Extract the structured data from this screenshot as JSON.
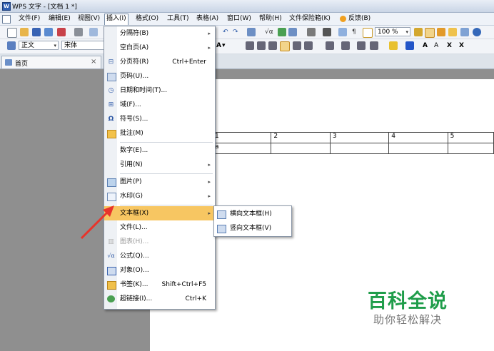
{
  "window": {
    "title": "WPS 文字 - [文档 1 *]"
  },
  "menubar": [
    "文件(F)",
    "编辑(E)",
    "视图(V)",
    "插入(I)",
    "格式(O)",
    "工具(T)",
    "表格(A)",
    "窗口(W)",
    "帮助(H)",
    "文件保险箱(K)",
    "反馈(B)"
  ],
  "toolbar1": {
    "zoom": "100 %"
  },
  "toolbar2": {
    "style": "正文",
    "font": "宋体",
    "size_label": "A",
    "format_buttons": [
      "A",
      "A",
      "X",
      "X"
    ]
  },
  "tabs": {
    "home": "首页",
    "close": "×"
  },
  "insert_menu": [
    {
      "label": "分隔符(B)",
      "icon": "",
      "submenu": true
    },
    {
      "label": "空白页(A)",
      "icon": "",
      "submenu": true
    },
    {
      "label": "分页符(R)",
      "icon": "page-break-icon",
      "shortcut": "Ctrl+Enter"
    },
    {
      "label": "页码(U)...",
      "icon": "page-number-icon"
    },
    {
      "label": "日期和时间(T)...",
      "icon": "date-time-icon"
    },
    {
      "label": "域(F)...",
      "icon": "field-icon"
    },
    {
      "label": "符号(S)...",
      "icon": "omega-icon"
    },
    {
      "label": "批注(M)",
      "icon": "comment-icon"
    },
    {
      "label": "数字(E)...",
      "icon": "",
      "separator_before": true
    },
    {
      "label": "引用(N)",
      "icon": "",
      "submenu": true
    },
    {
      "label": "图片(P)",
      "icon": "picture-icon",
      "submenu": true,
      "separator_before": true
    },
    {
      "label": "水印(G)",
      "icon": "watermark-icon",
      "submenu": true
    },
    {
      "label": "文本框(X)",
      "icon": "",
      "submenu": true,
      "highlighted": true,
      "separator_before": true
    },
    {
      "label": "文件(L)...",
      "icon": ""
    },
    {
      "label": "图表(H)...",
      "icon": "chart-icon",
      "disabled": true
    },
    {
      "label": "公式(Q)...",
      "icon": "formula-icon"
    },
    {
      "label": "对象(O)...",
      "icon": "object-icon"
    },
    {
      "label": "书签(K)...",
      "icon": "bookmark-icon",
      "shortcut": "Shift+Ctrl+F5"
    },
    {
      "label": "超链接(I)...",
      "icon": "hyperlink-icon",
      "shortcut": "Ctrl+K"
    }
  ],
  "textbox_submenu": [
    "横向文本框(H)",
    "竖向文本框(V)"
  ],
  "document": {
    "table_header": [
      "1",
      "2",
      "3",
      "4",
      "5"
    ],
    "table_row2": [
      "a",
      "",
      "",
      "",
      ""
    ]
  },
  "watermark": {
    "title": "百科全说",
    "subtitle": "助你轻松解决"
  },
  "colors": {
    "highlight": "#f7c662",
    "watermark_green": "#1f9d4a",
    "arrow": "#e8342b"
  }
}
